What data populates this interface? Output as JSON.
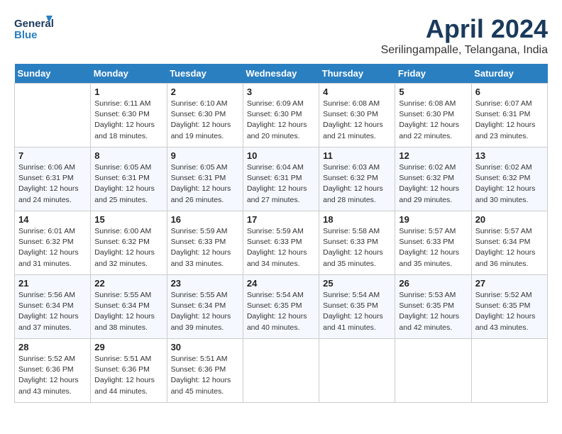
{
  "header": {
    "logo_general": "General",
    "logo_blue": "Blue",
    "month_title": "April 2024",
    "location": "Serilingampalle, Telangana, India"
  },
  "weekdays": [
    "Sunday",
    "Monday",
    "Tuesday",
    "Wednesday",
    "Thursday",
    "Friday",
    "Saturday"
  ],
  "weeks": [
    [
      {
        "day": "",
        "info": ""
      },
      {
        "day": "1",
        "info": "Sunrise: 6:11 AM\nSunset: 6:30 PM\nDaylight: 12 hours\nand 18 minutes."
      },
      {
        "day": "2",
        "info": "Sunrise: 6:10 AM\nSunset: 6:30 PM\nDaylight: 12 hours\nand 19 minutes."
      },
      {
        "day": "3",
        "info": "Sunrise: 6:09 AM\nSunset: 6:30 PM\nDaylight: 12 hours\nand 20 minutes."
      },
      {
        "day": "4",
        "info": "Sunrise: 6:08 AM\nSunset: 6:30 PM\nDaylight: 12 hours\nand 21 minutes."
      },
      {
        "day": "5",
        "info": "Sunrise: 6:08 AM\nSunset: 6:30 PM\nDaylight: 12 hours\nand 22 minutes."
      },
      {
        "day": "6",
        "info": "Sunrise: 6:07 AM\nSunset: 6:31 PM\nDaylight: 12 hours\nand 23 minutes."
      }
    ],
    [
      {
        "day": "7",
        "info": "Sunrise: 6:06 AM\nSunset: 6:31 PM\nDaylight: 12 hours\nand 24 minutes."
      },
      {
        "day": "8",
        "info": "Sunrise: 6:05 AM\nSunset: 6:31 PM\nDaylight: 12 hours\nand 25 minutes."
      },
      {
        "day": "9",
        "info": "Sunrise: 6:05 AM\nSunset: 6:31 PM\nDaylight: 12 hours\nand 26 minutes."
      },
      {
        "day": "10",
        "info": "Sunrise: 6:04 AM\nSunset: 6:31 PM\nDaylight: 12 hours\nand 27 minutes."
      },
      {
        "day": "11",
        "info": "Sunrise: 6:03 AM\nSunset: 6:32 PM\nDaylight: 12 hours\nand 28 minutes."
      },
      {
        "day": "12",
        "info": "Sunrise: 6:02 AM\nSunset: 6:32 PM\nDaylight: 12 hours\nand 29 minutes."
      },
      {
        "day": "13",
        "info": "Sunrise: 6:02 AM\nSunset: 6:32 PM\nDaylight: 12 hours\nand 30 minutes."
      }
    ],
    [
      {
        "day": "14",
        "info": "Sunrise: 6:01 AM\nSunset: 6:32 PM\nDaylight: 12 hours\nand 31 minutes."
      },
      {
        "day": "15",
        "info": "Sunrise: 6:00 AM\nSunset: 6:32 PM\nDaylight: 12 hours\nand 32 minutes."
      },
      {
        "day": "16",
        "info": "Sunrise: 5:59 AM\nSunset: 6:33 PM\nDaylight: 12 hours\nand 33 minutes."
      },
      {
        "day": "17",
        "info": "Sunrise: 5:59 AM\nSunset: 6:33 PM\nDaylight: 12 hours\nand 34 minutes."
      },
      {
        "day": "18",
        "info": "Sunrise: 5:58 AM\nSunset: 6:33 PM\nDaylight: 12 hours\nand 35 minutes."
      },
      {
        "day": "19",
        "info": "Sunrise: 5:57 AM\nSunset: 6:33 PM\nDaylight: 12 hours\nand 35 minutes."
      },
      {
        "day": "20",
        "info": "Sunrise: 5:57 AM\nSunset: 6:34 PM\nDaylight: 12 hours\nand 36 minutes."
      }
    ],
    [
      {
        "day": "21",
        "info": "Sunrise: 5:56 AM\nSunset: 6:34 PM\nDaylight: 12 hours\nand 37 minutes."
      },
      {
        "day": "22",
        "info": "Sunrise: 5:55 AM\nSunset: 6:34 PM\nDaylight: 12 hours\nand 38 minutes."
      },
      {
        "day": "23",
        "info": "Sunrise: 5:55 AM\nSunset: 6:34 PM\nDaylight: 12 hours\nand 39 minutes."
      },
      {
        "day": "24",
        "info": "Sunrise: 5:54 AM\nSunset: 6:35 PM\nDaylight: 12 hours\nand 40 minutes."
      },
      {
        "day": "25",
        "info": "Sunrise: 5:54 AM\nSunset: 6:35 PM\nDaylight: 12 hours\nand 41 minutes."
      },
      {
        "day": "26",
        "info": "Sunrise: 5:53 AM\nSunset: 6:35 PM\nDaylight: 12 hours\nand 42 minutes."
      },
      {
        "day": "27",
        "info": "Sunrise: 5:52 AM\nSunset: 6:35 PM\nDaylight: 12 hours\nand 43 minutes."
      }
    ],
    [
      {
        "day": "28",
        "info": "Sunrise: 5:52 AM\nSunset: 6:36 PM\nDaylight: 12 hours\nand 43 minutes."
      },
      {
        "day": "29",
        "info": "Sunrise: 5:51 AM\nSunset: 6:36 PM\nDaylight: 12 hours\nand 44 minutes."
      },
      {
        "day": "30",
        "info": "Sunrise: 5:51 AM\nSunset: 6:36 PM\nDaylight: 12 hours\nand 45 minutes."
      },
      {
        "day": "",
        "info": ""
      },
      {
        "day": "",
        "info": ""
      },
      {
        "day": "",
        "info": ""
      },
      {
        "day": "",
        "info": ""
      }
    ]
  ]
}
